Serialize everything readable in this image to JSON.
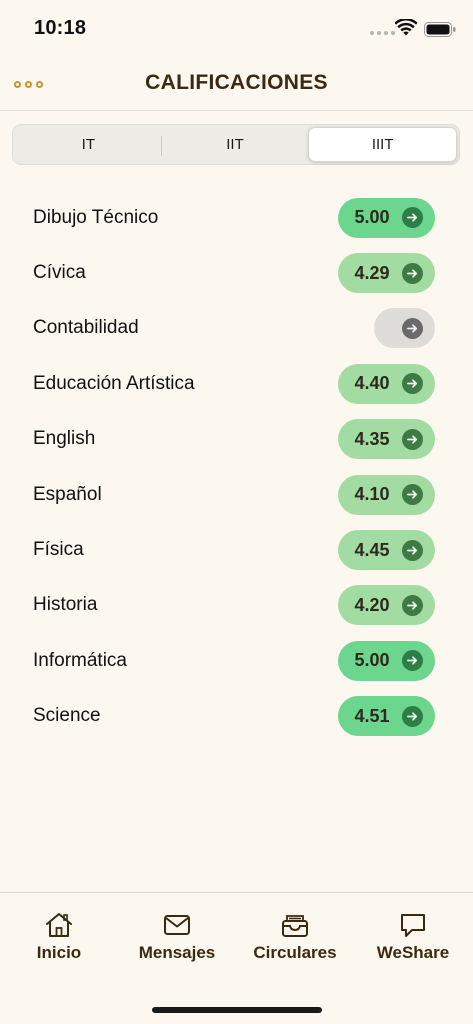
{
  "status_bar": {
    "time": "10:18"
  },
  "header": {
    "title": "CALIFICACIONES"
  },
  "segments": [
    {
      "label": "IT",
      "selected": false
    },
    {
      "label": "IIT",
      "selected": false
    },
    {
      "label": "IIIT",
      "selected": true
    }
  ],
  "grades": [
    {
      "subject": "Dibujo Técnico",
      "grade": "5.00",
      "color": "#6dd68e",
      "arrow_color": "#2e7d47"
    },
    {
      "subject": "Cívica",
      "grade": "4.29",
      "color": "#a3dca3",
      "arrow_color": "#3f7a45"
    },
    {
      "subject": "Contabilidad",
      "grade": "",
      "color": "#dedcd8",
      "arrow_color": "#6a6a6a"
    },
    {
      "subject": "Educación Artística",
      "grade": "4.40",
      "color": "#a3dca3",
      "arrow_color": "#3f7a45"
    },
    {
      "subject": "English",
      "grade": "4.35",
      "color": "#a3dca3",
      "arrow_color": "#3f7a45"
    },
    {
      "subject": "Español",
      "grade": "4.10",
      "color": "#a3dca3",
      "arrow_color": "#3f7a45"
    },
    {
      "subject": "Física",
      "grade": "4.45",
      "color": "#a3dca3",
      "arrow_color": "#3f7a45"
    },
    {
      "subject": "Historia",
      "grade": "4.20",
      "color": "#a3dca3",
      "arrow_color": "#3f7a45"
    },
    {
      "subject": "Informática",
      "grade": "5.00",
      "color": "#6dd68e",
      "arrow_color": "#2e7d47"
    },
    {
      "subject": "Science",
      "grade": "4.51",
      "color": "#6dd68e",
      "arrow_color": "#2e7d47"
    }
  ],
  "tabs": [
    {
      "label": "Inicio",
      "icon": "home-icon"
    },
    {
      "label": "Mensajes",
      "icon": "mail-icon"
    },
    {
      "label": "Circulares",
      "icon": "inbox-tray-icon"
    },
    {
      "label": "WeShare",
      "icon": "chat-bubble-icon"
    }
  ],
  "colors": {
    "background": "#fcf8f0",
    "accent_gold": "#c9952b",
    "title_brown": "#3a2a12"
  }
}
